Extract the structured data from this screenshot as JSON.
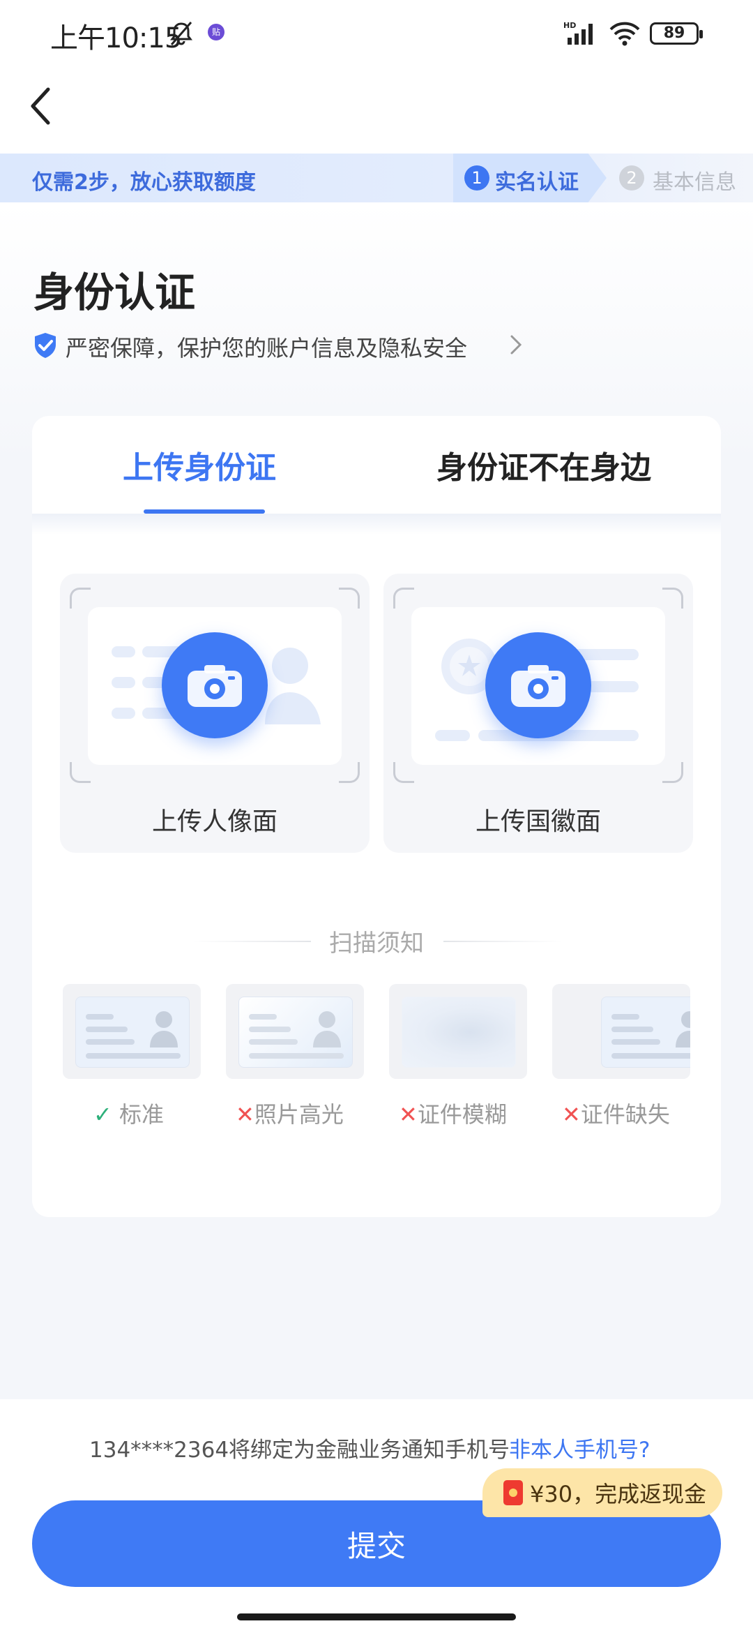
{
  "status_bar": {
    "time": "上午10:15",
    "note_badge": "贴",
    "battery": "89",
    "hd_label": "HD"
  },
  "nav": {
    "back_icon": "chevron-left-icon"
  },
  "banner": {
    "slogan": "仅需2步，放心获取额度",
    "steps": [
      {
        "num": "1",
        "label": "实名认证",
        "active": true
      },
      {
        "num": "2",
        "label": "基本信息",
        "active": false
      }
    ]
  },
  "page": {
    "title": "身份认证",
    "security_note": "严密保障，保护您的账户信息及隐私安全"
  },
  "tabs": [
    {
      "label": "上传身份证",
      "active": true
    },
    {
      "label": "身份证不在身边",
      "active": false
    }
  ],
  "upload": {
    "front_label": "上传人像面",
    "back_label": "上传国徽面"
  },
  "scan_notice": {
    "title": "扫描须知",
    "samples": [
      {
        "mark": "✓",
        "label": "标准",
        "ok": true
      },
      {
        "mark": "✕",
        "label": "照片高光",
        "ok": false
      },
      {
        "mark": "✕",
        "label": "证件模糊",
        "ok": false
      },
      {
        "mark": "✕",
        "label": "证件缺失",
        "ok": false
      }
    ]
  },
  "bottom": {
    "bind_text": "134****2364将绑定为金融业务通知手机号",
    "bind_link": "非本人手机号?",
    "cashback": "¥30，完成返现金",
    "submit": "提交"
  },
  "colors": {
    "accent": "#3f7af5",
    "banner_text": "#3d6bdc",
    "ok": "#2db07a",
    "error": "#f05252",
    "cashback_bg": "#fde5a8"
  }
}
